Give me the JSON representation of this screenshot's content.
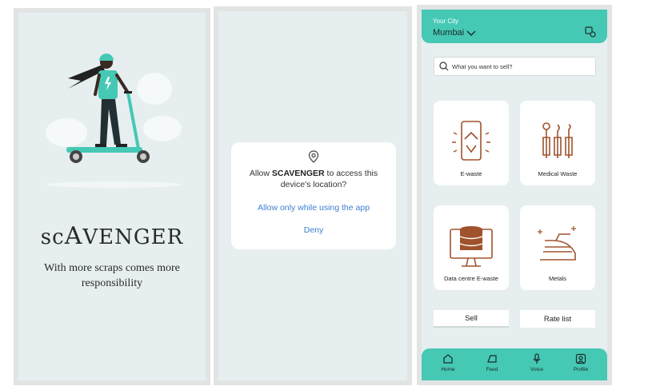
{
  "splash": {
    "brand_pre": "sc",
    "brand_big": "A",
    "brand_post": "VENGER",
    "tagline": "With more scraps comes more responsibility"
  },
  "permission": {
    "message_pre": "Allow ",
    "app_name": "SCAVENGER",
    "message_post": " to access this device's location?",
    "option_allow": "Allow only while using the app",
    "option_deny": "Deny"
  },
  "home": {
    "city_label": "Your City",
    "city_value": "Mumbai",
    "search_placeholder": "What you want to sell?",
    "categories": [
      {
        "label": "E-waste",
        "icon": "phone-recycle-icon"
      },
      {
        "label": "Medical Waste",
        "icon": "medical-tools-icon"
      },
      {
        "label": "Data centre E-waste",
        "icon": "database-monitor-icon"
      },
      {
        "label": "Metals",
        "icon": "iron-icon"
      }
    ],
    "sell_label": "Sell",
    "rate_list_label": "Rate list",
    "nav": [
      {
        "label": "Home",
        "icon": "home-icon"
      },
      {
        "label": "Feed",
        "icon": "feed-icon"
      },
      {
        "label": "Voice",
        "icon": "mic-icon"
      },
      {
        "label": "Profile",
        "icon": "profile-icon"
      }
    ]
  },
  "colors": {
    "accent": "#45c8b4",
    "icon_brown": "#a0522d",
    "link_blue": "#3d7fd0",
    "screen_bg": "#e6eef0"
  }
}
